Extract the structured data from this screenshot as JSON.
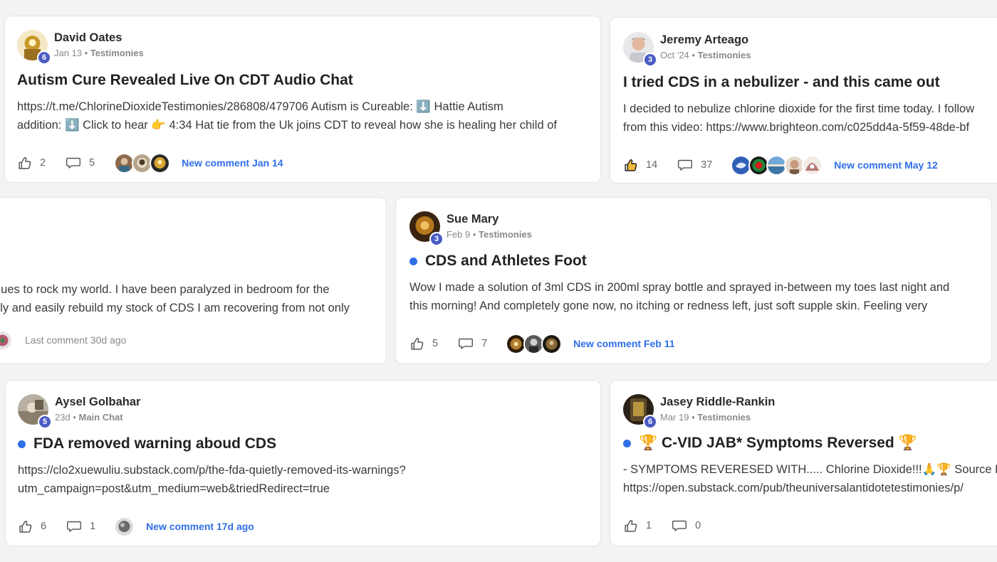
{
  "posts": [
    {
      "author": "David Oates",
      "level": "6",
      "date": "Jan 13",
      "sep": " • ",
      "category": "Testimonies",
      "title": "Autism Cure Revealed Live On CDT Audio Chat",
      "line1": "https://t.me/ChlorineDioxideTestimonies/286808/479706 Autism is Cureable: ⬇️ Hattie Autism",
      "line2": "addition: ⬇️ Click to hear 👉 4:34 Hat tie from the Uk joins CDT to reveal how she is healing her child of",
      "likes": "2",
      "comments": "5",
      "activity": "New comment Jan 14",
      "avatar_color": "#c9982a",
      "faces": [
        "#8c6a4a",
        "#b5a58a",
        "#d8a430"
      ]
    },
    {
      "author": "Jeremy Arteago",
      "level": "3",
      "date": "Oct '24",
      "sep": " • ",
      "category": "Testimonies",
      "title": "I tried CDS in a nebulizer - and this came out",
      "line1": "I decided to nebulize chlorine dioxide for the first time today. I follow",
      "line2": "from this video: https://www.brighteon.com/c025dd4a-5f59-48de-bf",
      "likes": "14",
      "comments": "37",
      "activity": "New comment May 12",
      "avatar_color": "#d7b5a0",
      "faces": [
        "#2f5fb7",
        "#1d8a3a",
        "#6fa7d8",
        "#c99a7c",
        "#b47a78"
      ]
    },
    {
      "line1": "nues to rock my world. I have been paralyzed in bedroom for the",
      "line2": "kly and easily rebuild my stock of CDS I am recovering from not only",
      "activity": "Last comment 30d ago",
      "faces": [
        "#b35a6e"
      ]
    },
    {
      "author": "Sue Mary",
      "level": "3",
      "date": "Feb 9",
      "sep": " • ",
      "category": "Testimonies",
      "title": "CDS and Athletes Foot",
      "line1": "Wow I made a solution of 3ml CDS in 200ml spray bottle and sprayed in-between my toes last night and",
      "line2": "this morning! And completely gone now, no itching or redness left, just soft supple skin. Feeling very",
      "likes": "5",
      "comments": "7",
      "activity": "New comment Feb 11",
      "avatar_color": "#7a5020",
      "faces": [
        "#b07a30",
        "#5a5a5a",
        "#8a6a3a"
      ]
    },
    {
      "author": "Aysel Golbahar",
      "level": "5",
      "date": "23d",
      "sep": " • ",
      "category": "Main Chat",
      "title": "FDA removed warning aboud CDS",
      "line1": "https://clo2xuewuliu.substack.com/p/the-fda-quietly-removed-its-warnings?",
      "line2": "utm_campaign=post&utm_medium=web&triedRedirect=true",
      "likes": "6",
      "comments": "1",
      "activity": "New comment 17d ago",
      "avatar_color": "#b8b0a2",
      "faces": [
        "#6a6a6a"
      ]
    },
    {
      "author": "Jasey Riddle-Rankin",
      "level": "6",
      "date": "Mar 19",
      "sep": " • ",
      "category": "Testimonies",
      "title": "🏆 C-VID JAB* Symptoms Reversed 🏆",
      "line1": "- SYMPTOMS REVERESED WITH..... Chlorine Dioxide!!!🙏🏆 Source L",
      "line2": "https://open.substack.com/pub/theuniversalantidotetestimonies/p/",
      "likes": "1",
      "comments": "0"
    }
  ],
  "colors": {
    "accent": "#2f6ee8",
    "badge": "#4a5bc4"
  },
  "icons": {
    "like": "thumbs-up-icon",
    "comment": "speech-bubble-icon",
    "new": "unread-dot-icon"
  }
}
